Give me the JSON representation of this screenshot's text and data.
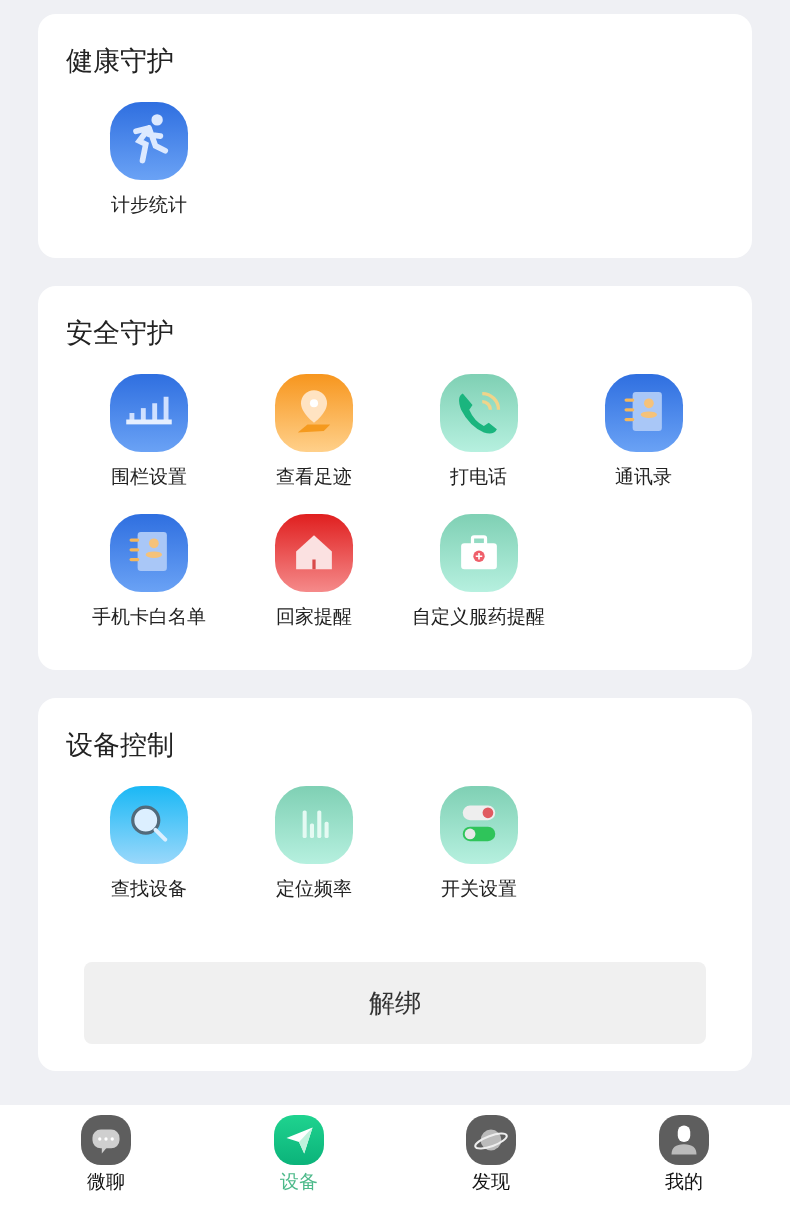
{
  "sections": [
    {
      "title": "健康守护",
      "items": [
        {
          "label": "计步统计"
        }
      ]
    },
    {
      "title": "安全守护",
      "items": [
        {
          "label": "围栏设置"
        },
        {
          "label": "查看足迹"
        },
        {
          "label": "打电话"
        },
        {
          "label": "通讯录"
        },
        {
          "label": "手机卡白名单"
        },
        {
          "label": "回家提醒"
        },
        {
          "label": "自定义服药提醒"
        }
      ]
    },
    {
      "title": "设备控制",
      "items": [
        {
          "label": "查找设备"
        },
        {
          "label": "定位频率"
        },
        {
          "label": "开关设置"
        }
      ],
      "button": "解绑"
    }
  ],
  "tabs": [
    {
      "label": "微聊",
      "selected": false
    },
    {
      "label": "设备",
      "selected": true
    },
    {
      "label": "发现",
      "selected": false
    },
    {
      "label": "我的",
      "selected": false
    }
  ]
}
